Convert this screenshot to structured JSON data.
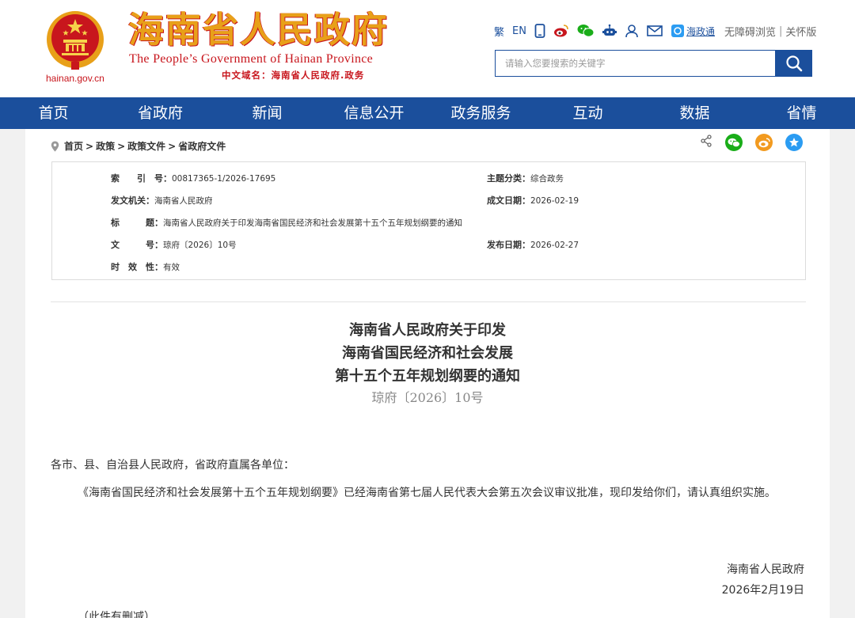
{
  "header": {
    "site_title": "海南省人民政府",
    "site_subtitle_en": "The People’s Government  of Hainan Province",
    "site_subtitle_cn": "中文域名：海南省人民政府.政务",
    "domain": "hainan.gov.cn",
    "top_links": {
      "traditional": "繁",
      "english": "EN",
      "hzt_label": "海政通",
      "accessible": "无障碍浏览",
      "care_mode": "关怀版",
      "separator": "|"
    },
    "search": {
      "placeholder": "请输入您要搜索的关键字"
    }
  },
  "nav": {
    "items": [
      "首页",
      "省政府",
      "新闻",
      "信息公开",
      "政务服务",
      "互动",
      "数据",
      "省情"
    ]
  },
  "breadcrumb": {
    "items": [
      "首页",
      "政策",
      "政策文件",
      "省政府文件"
    ],
    "separator": ">"
  },
  "meta": {
    "index_label": "索　　引　号：",
    "index_value": "00817365-1/2026-17695",
    "topic_label": "主题分类：",
    "topic_value": "综合政务",
    "issuer_label": "发文机关：",
    "issuer_value": "海南省人民政府",
    "created_label": "成文日期：",
    "created_value": "2026-02-19",
    "title_label": "标　　　题：",
    "title_value": "海南省人民政府关于印发海南省国民经济和社会发展第十五个五年规划纲要的通知",
    "docno_label": "文　　　号：",
    "docno_value": "琼府〔2026〕10号",
    "published_label": "发布日期：",
    "published_value": "2026-02-27",
    "validity_label": "时　效　性：",
    "validity_value": "有效"
  },
  "document": {
    "title_lines": [
      "海南省人民政府关于印发",
      "海南省国民经济和社会发展",
      "第十五个五年规划纲要的通知"
    ],
    "doc_number": "琼府〔2026〕10号",
    "salutation": "各市、县、自治县人民政府，省政府直属各单位：",
    "paragraph": "《海南省国民经济和社会发展第十五个五年规划纲要》已经海南省第七届人民代表大会第五次会议审议批准，现印发给你们，请认真组织实施。",
    "signer": "海南省人民政府",
    "sign_date": "2026年2月19日",
    "footnote": "（此件有删减）"
  },
  "colors": {
    "brand_blue": "#1b4f9c",
    "brand_red": "#c8161d",
    "brand_gold": "#e8a019",
    "wechat_green": "#1aad19",
    "weibo_orange": "#f29a1f",
    "qzone_blue": "#2b9cf2"
  },
  "icons": [
    "phone-icon",
    "weibo-icon",
    "wechat-icon",
    "robot-icon",
    "user-icon",
    "mail-icon",
    "hzt-icon",
    "search-icon",
    "location-pin-icon",
    "share-icon",
    "wechat-share-icon",
    "weibo-share-icon",
    "qzone-share-icon",
    "national-emblem-icon"
  ]
}
